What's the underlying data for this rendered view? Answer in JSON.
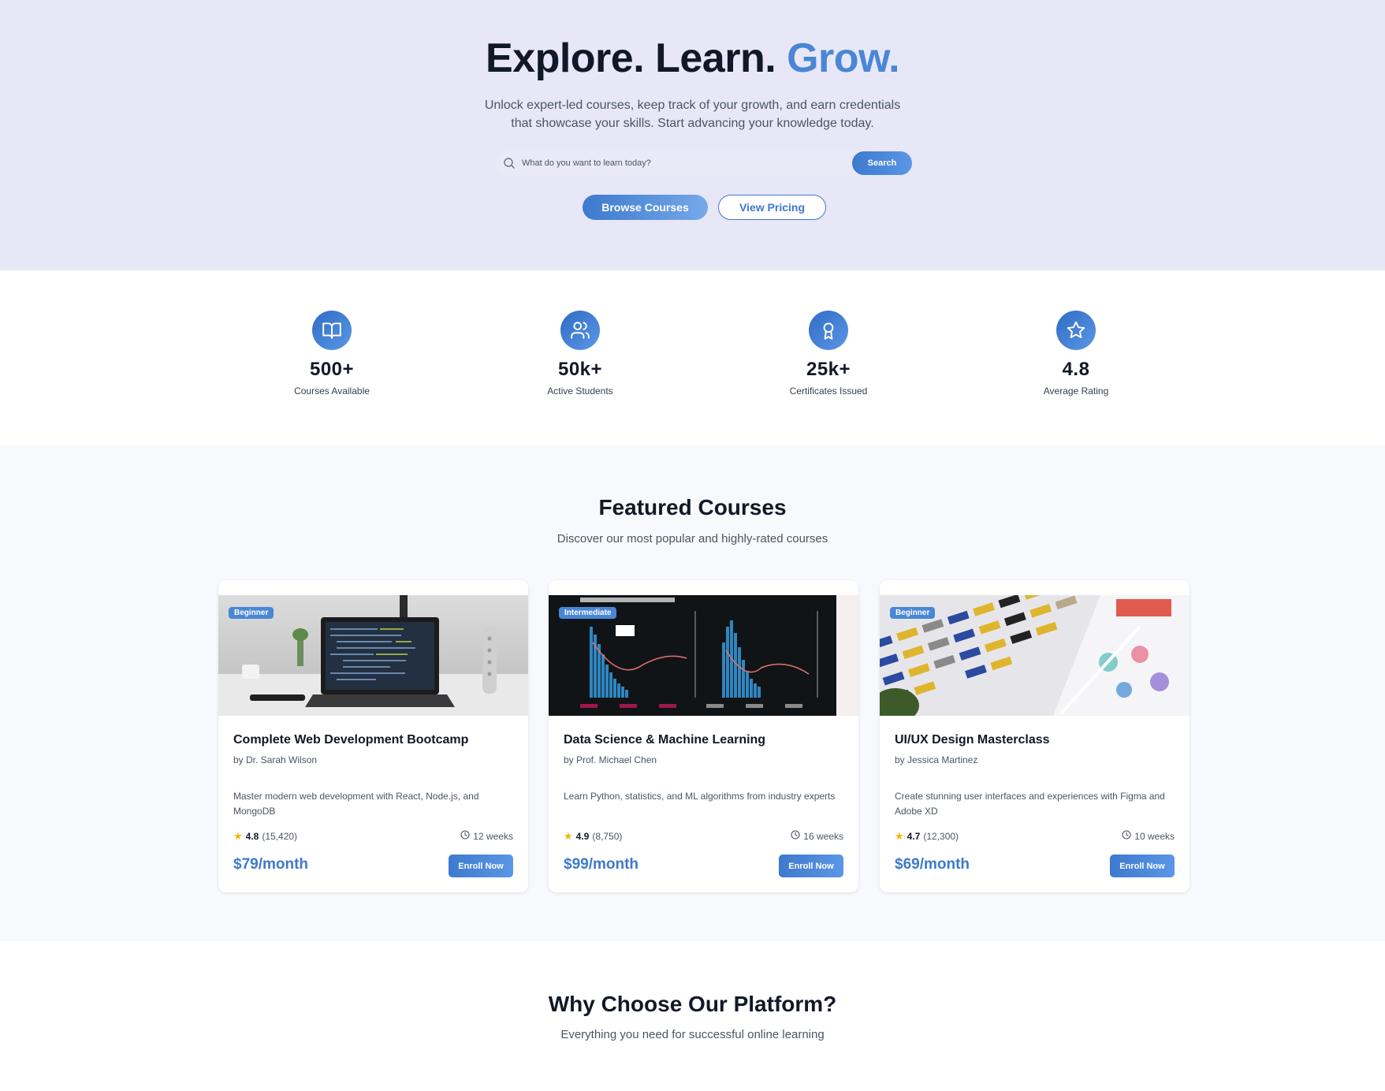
{
  "hero": {
    "title_main": "Explore. Learn.",
    "title_accent": "Grow.",
    "subtitle_line1": "Unlock expert-led courses, keep track of your growth, and earn credentials",
    "subtitle_line2": "that showcase your skills. Start advancing your knowledge today.",
    "search_placeholder": "What do you want to learn today?",
    "search_button": "Search",
    "browse_button": "Browse Courses",
    "pricing_button": "View Pricing"
  },
  "stats": [
    {
      "value": "500+",
      "label": "Courses Available",
      "icon": "book-icon"
    },
    {
      "value": "50k+",
      "label": "Active Students",
      "icon": "users-icon"
    },
    {
      "value": "25k+",
      "label": "Certificates Issued",
      "icon": "award-icon"
    },
    {
      "value": "4.8",
      "label": "Average Rating",
      "icon": "star-icon"
    }
  ],
  "featured": {
    "title": "Featured Courses",
    "subtitle": "Discover our most popular and highly-rated courses",
    "courses": [
      {
        "level": "Beginner",
        "title": "Complete Web Development Bootcamp",
        "author": "by Dr. Sarah Wilson",
        "description": "Master modern web development with React, Node.js, and MongoDB",
        "rating": "4.8",
        "reviews": "(15,420)",
        "duration": "12 weeks",
        "price": "$79/month",
        "enroll": "Enroll Now"
      },
      {
        "level": "Intermediate",
        "title": "Data Science & Machine Learning",
        "author": "by Prof. Michael Chen",
        "description": "Learn Python, statistics, and ML algorithms from industry experts",
        "rating": "4.9",
        "reviews": "(8,750)",
        "duration": "16 weeks",
        "price": "$99/month",
        "enroll": "Enroll Now"
      },
      {
        "level": "Beginner",
        "title": "UI/UX Design Masterclass",
        "author": "by Jessica Martinez",
        "description": "Create stunning user interfaces and experiences with Figma and Adobe XD",
        "rating": "4.7",
        "reviews": "(12,300)",
        "duration": "10 weeks",
        "price": "$69/month",
        "enroll": "Enroll Now"
      }
    ]
  },
  "why": {
    "title": "Why Choose Our Platform?",
    "subtitle": "Everything you need for successful online learning"
  },
  "colors": {
    "accent": "#4a86d6",
    "primary": "#3d79cd",
    "hero_bg": "#e7e7f8",
    "star": "#f5b301"
  }
}
